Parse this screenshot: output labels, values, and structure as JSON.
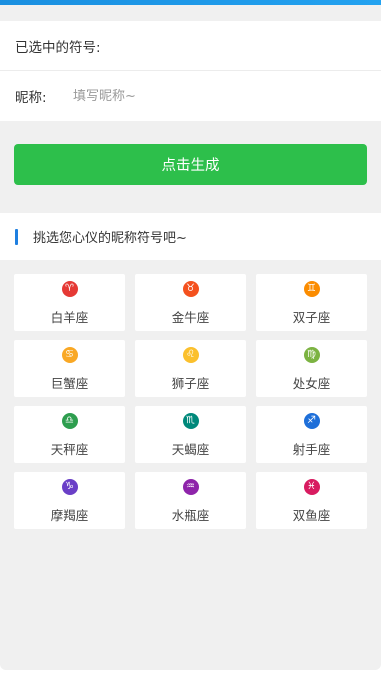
{
  "form": {
    "selected_label": "已选中的符号:",
    "nickname_label": "昵称:",
    "nickname_placeholder": "填写昵称~",
    "nickname_value": ""
  },
  "generate_button": "点击生成",
  "section": {
    "title": "挑选您心仪的昵称符号吧~"
  },
  "zodiacs": [
    {
      "name": "白羊座",
      "symbol": "♈",
      "icon": "aries-icon",
      "color": "#e53935"
    },
    {
      "name": "金牛座",
      "symbol": "♉",
      "icon": "taurus-icon",
      "color": "#f4511e"
    },
    {
      "name": "双子座",
      "symbol": "♊",
      "icon": "gemini-icon",
      "color": "#fb8c00"
    },
    {
      "name": "巨蟹座",
      "symbol": "♋",
      "icon": "cancer-icon",
      "color": "#f9a825"
    },
    {
      "name": "狮子座",
      "symbol": "♌",
      "icon": "leo-icon",
      "color": "#fbc02d"
    },
    {
      "name": "处女座",
      "symbol": "♍",
      "icon": "virgo-icon",
      "color": "#7cb342"
    },
    {
      "name": "天秤座",
      "symbol": "♎",
      "icon": "libra-icon",
      "color": "#2e9e4f"
    },
    {
      "name": "天蝎座",
      "symbol": "♏",
      "icon": "scorpio-icon",
      "color": "#00897b"
    },
    {
      "name": "射手座",
      "symbol": "♐",
      "icon": "sagittarius-icon",
      "color": "#1e6fd9"
    },
    {
      "name": "摩羯座",
      "symbol": "♑",
      "icon": "capricorn-icon",
      "color": "#6a3fc7"
    },
    {
      "name": "水瓶座",
      "symbol": "♒",
      "icon": "aquarius-icon",
      "color": "#8e24aa"
    },
    {
      "name": "双鱼座",
      "symbol": "♓",
      "icon": "pisces-icon",
      "color": "#d81b60"
    }
  ],
  "colors": {
    "accent_top": "#1a8fe0",
    "button_green": "#2dbf4b",
    "section_bar": "#1e7fe0",
    "background": "#f0f0f0"
  }
}
